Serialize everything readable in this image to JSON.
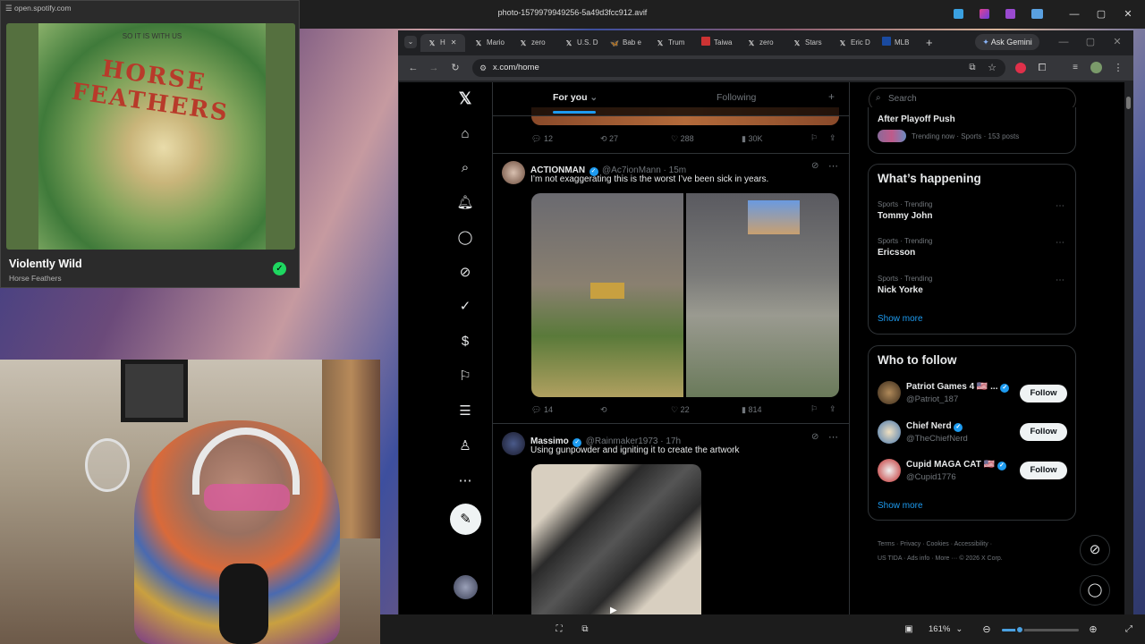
{
  "viewer": {
    "title": "photo-1579979949256-5a49d3fcc912.avif",
    "zoom": "161%",
    "window_controls": [
      "—",
      "▢",
      "✕"
    ]
  },
  "spotify": {
    "url": "open.spotify.com",
    "song": "Violently Wild",
    "artist": "Horse Feathers",
    "album_art_title": "HORSE FEATHERS",
    "album_art_subtitle": "SO IT IS WITH US"
  },
  "chrome": {
    "url": "x.com/home",
    "ask_gemini": "Ask Gemini",
    "tabs": [
      {
        "icon": "x-logo-icon",
        "label": "H"
      },
      {
        "icon": "x-logo-icon",
        "label": "Mario"
      },
      {
        "icon": "x-logo-icon",
        "label": "zero"
      },
      {
        "icon": "x-logo-icon",
        "label": "U.S. D"
      },
      {
        "icon": "bluesky-icon",
        "label": "Bab e"
      },
      {
        "icon": "x-logo-icon",
        "label": "Trum"
      },
      {
        "icon": "flag-icon",
        "label": "Taiwa"
      },
      {
        "icon": "x-logo-icon",
        "label": "zero"
      },
      {
        "icon": "x-logo-icon",
        "label": "Stars"
      },
      {
        "icon": "x-logo-icon",
        "label": "Eric D"
      },
      {
        "icon": "mlb-icon",
        "label": "MLB"
      }
    ]
  },
  "x": {
    "feed_tabs": {
      "for_you": "For you",
      "following": "Following"
    },
    "prev_tweet_stats": {
      "replies": "12",
      "retweets": "27",
      "likes": "288",
      "views": "30K"
    },
    "tweets": [
      {
        "name": "ACTIONMAN",
        "handle": "@Ac7ionMann",
        "time": "15m",
        "text": "I’m not exaggerating this is the worst I’ve been sick in years.",
        "stats": {
          "replies": "14",
          "retweets": "",
          "likes": "22",
          "views": "814"
        }
      },
      {
        "name": "Massimo",
        "handle": "@Rainmaker1973",
        "time": "17h",
        "text": "Using gunpowder and igniting it to create the artwork"
      }
    ],
    "search_placeholder": "Search",
    "trending_top": {
      "title": "After Playoff Push",
      "meta": "Trending now · Sports · 153 posts"
    },
    "whats_happening": {
      "heading": "What’s happening",
      "items": [
        {
          "meta": "Sports · Trending",
          "title": "Tommy John"
        },
        {
          "meta": "Sports · Trending",
          "title": "Ericsson"
        },
        {
          "meta": "Sports · Trending",
          "title": "Nick Yorke"
        }
      ],
      "show_more": "Show more"
    },
    "who_to_follow": {
      "heading": "Who to follow",
      "accounts": [
        {
          "name": "Patriot Games 4 🇺🇸 ...",
          "handle": "@Patriot_187",
          "button": "Follow"
        },
        {
          "name": "Chief Nerd",
          "handle": "@TheChiefNerd",
          "button": "Follow"
        },
        {
          "name": "Cupid MAGA CAT 🇺🇸",
          "handle": "@Cupid1776",
          "button": "Follow"
        }
      ],
      "show_more": "Show more"
    },
    "footer": {
      "line1": [
        "Terms",
        "Privacy",
        "Cookies",
        "Accessibility"
      ],
      "line2": [
        "US TIDA",
        "Ads info",
        "More ···",
        "© 2026 X Corp."
      ]
    }
  }
}
